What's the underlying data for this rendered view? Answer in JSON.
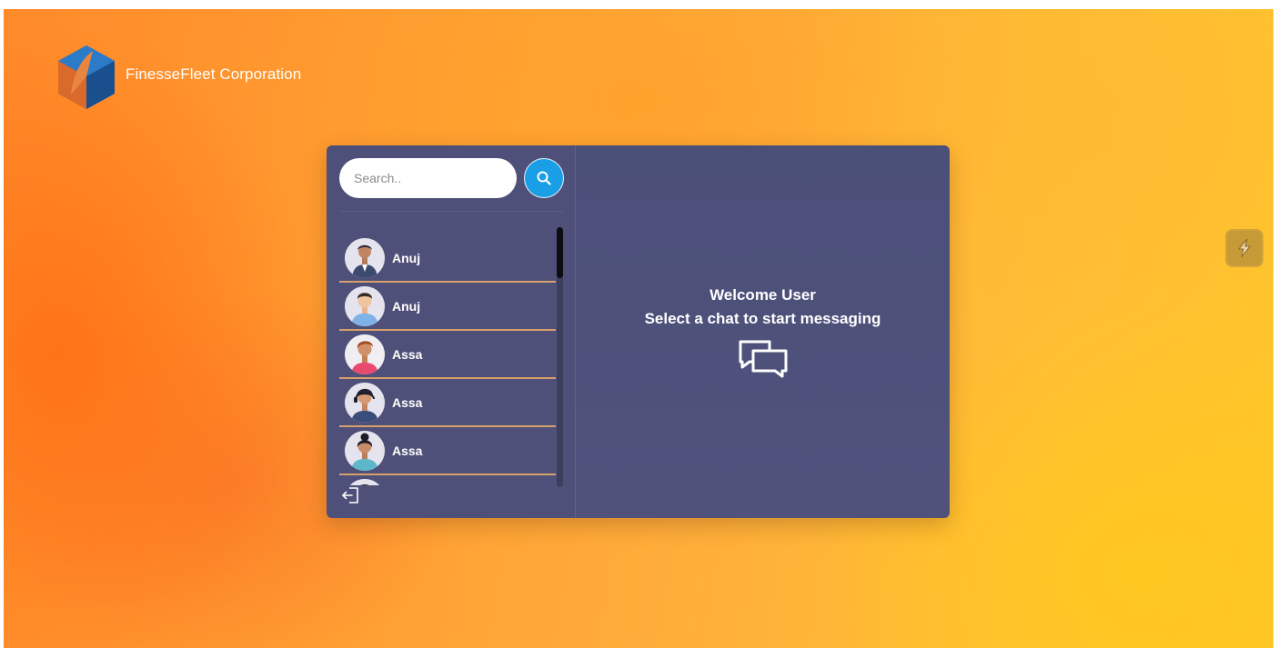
{
  "brand": {
    "name": "FinesseFleet Corporation",
    "logo_icon": "cube-logo-icon"
  },
  "search": {
    "placeholder": "Search..",
    "value": "",
    "button_icon": "search-icon"
  },
  "contacts": [
    {
      "name": "Anuj",
      "avatar": "avatar-man-dark-suit"
    },
    {
      "name": "Anuj",
      "avatar": "avatar-man-blue-shirt"
    },
    {
      "name": "Assa",
      "avatar": "avatar-woman-pink"
    },
    {
      "name": "Assa",
      "avatar": "avatar-woman-headset"
    },
    {
      "name": "Assa",
      "avatar": "avatar-woman-bun"
    },
    {
      "name": "",
      "avatar": "avatar-partial"
    }
  ],
  "welcome": {
    "line1": "Welcome User",
    "line2": "Select a chat to start messaging",
    "icon": "chat-bubbles-icon"
  },
  "sidebar_footer": {
    "logout_icon": "logout-icon"
  },
  "side_widget": {
    "icon": "lightning-icon"
  },
  "colors": {
    "panel": "#4f5079",
    "accent": "#1a9ee6",
    "divider": "#d7a06a"
  }
}
